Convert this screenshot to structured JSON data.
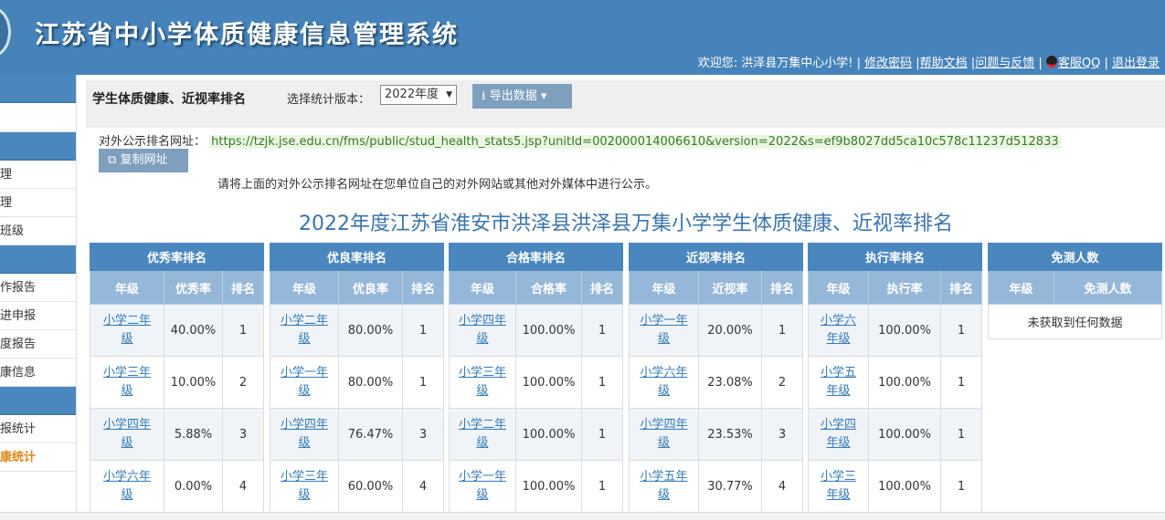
{
  "header": {
    "title": "江苏省中小学体质健康信息管理系统",
    "welcome": "欢迎您: 洪泽县万集中心小学!",
    "links": [
      "修改密码",
      "帮助文档",
      "问题与反馈",
      "客服QQ",
      "退出登录"
    ]
  },
  "sidebar": {
    "items": [
      "理",
      "理",
      "班级",
      "作报告",
      "进申报",
      "度报告",
      "康信息",
      "报统计",
      "康统计"
    ]
  },
  "toolbar": {
    "title": "学生体质健康、近视率排名",
    "version_label": "选择统计版本：",
    "version_value": "2022年度",
    "export_label": "导出数据"
  },
  "url": {
    "label": "对外公示排名网址：",
    "value": "https://tzjk.jse.edu.cn/fms/public/stud_health_stats5.jsp?unitId=002000014006610&version=2022&s=ef9b8027dd5ca10c578c11237d512833",
    "copy_label": "复制网址",
    "notice": "请将上面的对外公示排名网址在您单位自己的对外网站或其他对外媒体中进行公示。"
  },
  "report_title": "2022年度江苏省淮安市洪泽县洪泽县万集小学学生体质健康、近视率排名",
  "tables": {
    "excellent": {
      "title": "优秀率排名",
      "cols": [
        "年级",
        "优秀率",
        "排名"
      ],
      "rows": [
        {
          "g1": "小学二年",
          "g2": "级",
          "v": "40.00%",
          "r": "1"
        },
        {
          "g1": "小学三年",
          "g2": "级",
          "v": "10.00%",
          "r": "2"
        },
        {
          "g1": "小学四年",
          "g2": "级",
          "v": "5.88%",
          "r": "3"
        },
        {
          "g1": "小学六年",
          "g2": "级",
          "v": "0.00%",
          "r": "4"
        }
      ]
    },
    "good": {
      "title": "优良率排名",
      "cols": [
        "年级",
        "优良率",
        "排名"
      ],
      "rows": [
        {
          "g1": "小学二年",
          "g2": "级",
          "v": "80.00%",
          "r": "1"
        },
        {
          "g1": "小学一年",
          "g2": "级",
          "v": "80.00%",
          "r": "1"
        },
        {
          "g1": "小学四年",
          "g2": "级",
          "v": "76.47%",
          "r": "3"
        },
        {
          "g1": "小学三年",
          "g2": "级",
          "v": "60.00%",
          "r": "4"
        }
      ]
    },
    "pass": {
      "title": "合格率排名",
      "cols": [
        "年级",
        "合格率",
        "排名"
      ],
      "rows": [
        {
          "g1": "小学四年",
          "g2": "级",
          "v": "100.00%",
          "r": "1"
        },
        {
          "g1": "小学三年",
          "g2": "级",
          "v": "100.00%",
          "r": "1"
        },
        {
          "g1": "小学二年",
          "g2": "级",
          "v": "100.00%",
          "r": "1"
        },
        {
          "g1": "小学一年",
          "g2": "级",
          "v": "100.00%",
          "r": "1"
        }
      ]
    },
    "myopia": {
      "title": "近视率排名",
      "cols": [
        "年级",
        "近视率",
        "排名"
      ],
      "rows": [
        {
          "g1": "小学一年",
          "g2": "级",
          "v": "20.00%",
          "r": "1"
        },
        {
          "g1": "小学六年",
          "g2": "级",
          "v": "23.08%",
          "r": "2"
        },
        {
          "g1": "小学四年",
          "g2": "级",
          "v": "23.53%",
          "r": "3"
        },
        {
          "g1": "小学五年",
          "g2": "级",
          "v": "30.77%",
          "r": "4"
        }
      ]
    },
    "execution": {
      "title": "执行率排名",
      "cols": [
        "年级",
        "执行率",
        "排名"
      ],
      "rows": [
        {
          "g1": "小学六",
          "g2": "年级",
          "v": "100.00%",
          "r": "1"
        },
        {
          "g1": "小学五",
          "g2": "年级",
          "v": "100.00%",
          "r": "1"
        },
        {
          "g1": "小学四",
          "g2": "年级",
          "v": "100.00%",
          "r": "1"
        },
        {
          "g1": "小学三",
          "g2": "年级",
          "v": "100.00%",
          "r": "1"
        }
      ]
    },
    "exempt": {
      "title": "免测人数",
      "cols": [
        "年级",
        "免测人数"
      ],
      "empty": "未获取到任何数据"
    }
  }
}
